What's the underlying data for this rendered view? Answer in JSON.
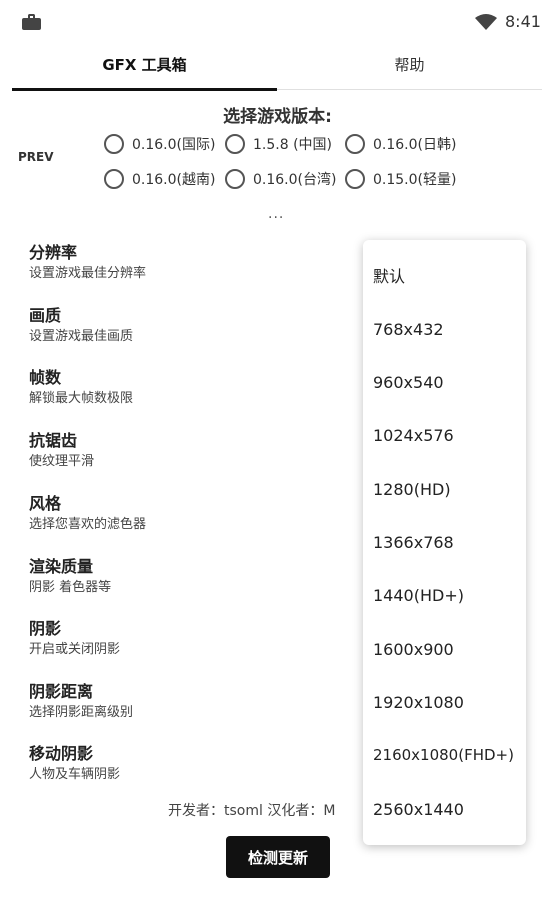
{
  "status_bar": {
    "time": "8:41"
  },
  "tabs": [
    {
      "label": "GFX 工具箱"
    },
    {
      "label": "帮助"
    }
  ],
  "version": {
    "title": "选择游戏版本:",
    "prev_label": "PREV",
    "options": [
      "0.16.0(国际)",
      "1.5.8 (中国)",
      "0.16.0(日韩)",
      "0.16.0(越南)",
      "0.16.0(台湾)",
      "0.15.0(轻量)"
    ],
    "more": "..."
  },
  "settings": [
    {
      "title": "分辨率",
      "desc": "设置游戏最佳分辨率"
    },
    {
      "title": "画质",
      "desc": "设置游戏最佳画质"
    },
    {
      "title": "帧数",
      "desc": "解锁最大帧数极限"
    },
    {
      "title": "抗锯齿",
      "desc": "使纹理平滑"
    },
    {
      "title": "风格",
      "desc": "选择您喜欢的滤色器"
    },
    {
      "title": "渲染质量",
      "desc": "阴影 着色器等"
    },
    {
      "title": "阴影",
      "desc": "开启或关闭阴影"
    },
    {
      "title": "阴影距离",
      "desc": "选择阴影距离级别"
    },
    {
      "title": "移动阴影",
      "desc": "人物及车辆阴影"
    }
  ],
  "footer": {
    "credit": "开发者：tsoml   汉化者：M",
    "check_update": "检测更新"
  },
  "dropdown": {
    "options": [
      "默认",
      "768x432",
      "960x540",
      "1024x576",
      "1280(HD)",
      "1366x768",
      "1440(HD+)",
      "1600x900",
      "1920x1080",
      "2160x1080(FHD+)",
      "2560x1440"
    ]
  }
}
